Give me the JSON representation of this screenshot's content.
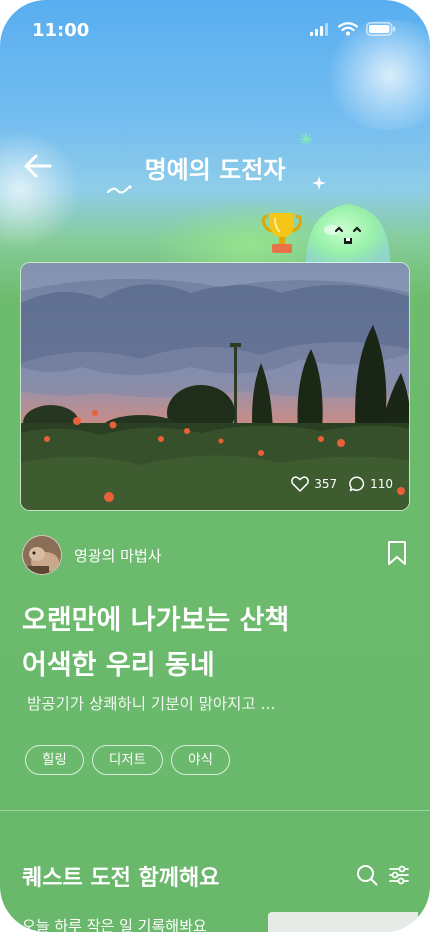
{
  "status_bar": {
    "time": "11:00"
  },
  "header": {
    "title": "명예의 도전자"
  },
  "post": {
    "likes": "357",
    "comments": "110",
    "author": "영광의 마법사",
    "title_lines": [
      "오랜만에 나가보는 산책",
      "어색한 우리 동네"
    ],
    "description": "밤공기가 상쾌하니 기분이 맑아지고 ...",
    "tags": [
      "힐링",
      "디저트",
      "야식"
    ]
  },
  "quest": {
    "section_title": "퀘스트 도전 함께해요",
    "first_item": "오늘 하루 작은 일 기록해봐요"
  },
  "colors": {
    "sky_top": "#58aef0",
    "grass": "#6ab86b",
    "accent_trophy": "#f5c518"
  }
}
